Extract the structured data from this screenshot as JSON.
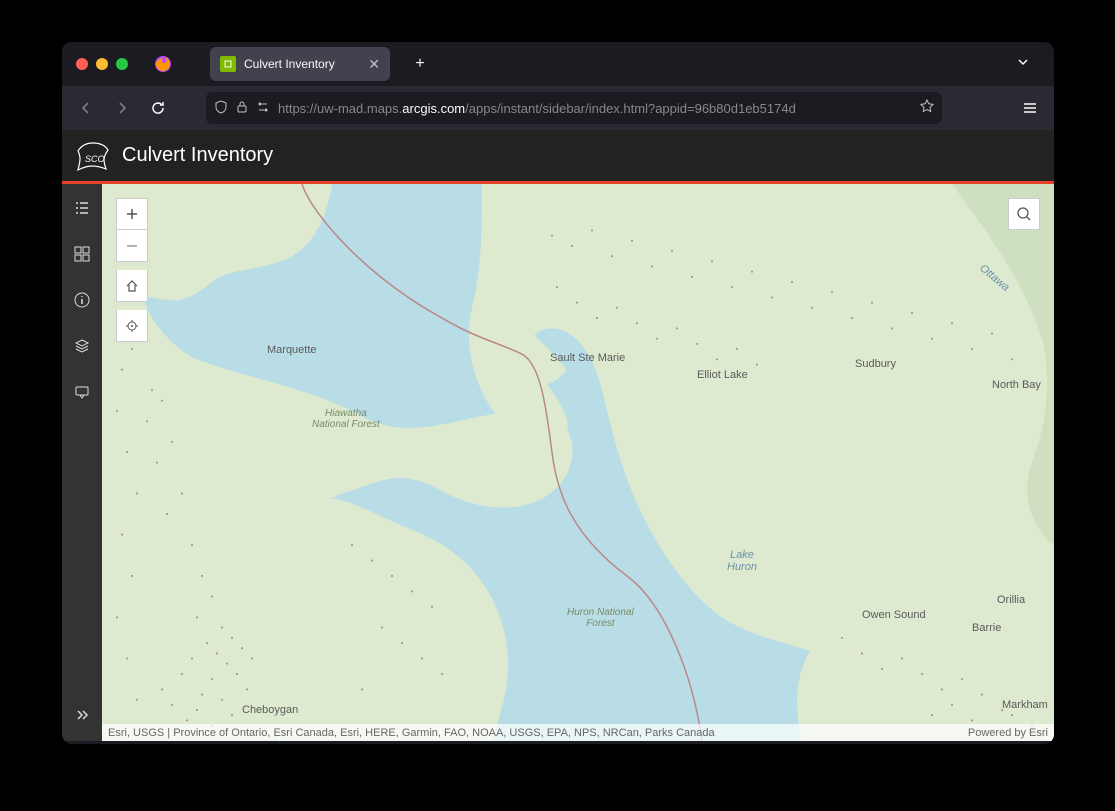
{
  "browser": {
    "tab_title": "Culvert Inventory",
    "url_prefix": "https://uw-mad.maps.",
    "url_bold": "arcgis.com",
    "url_suffix": "/apps/instant/sidebar/index.html?appid=96b80d1eb5174d"
  },
  "app": {
    "logo_text": "SCO",
    "title": "Culvert Inventory"
  },
  "map": {
    "attribution_left": "Esri, USGS | Province of Ontario, Esri Canada, Esri, HERE, Garmin, FAO, NOAA, USGS, EPA, NPS, NRCan, Parks Canada",
    "attribution_right": "Powered by Esri",
    "labels": {
      "marquette": "Marquette",
      "sault": "Sault Ste Marie",
      "elliot": "Elliot Lake",
      "sudbury": "Sudbury",
      "northbay": "North Bay",
      "orillia": "Orillia",
      "barrie": "Barrie",
      "owensound": "Owen Sound",
      "markham": "Markham",
      "cheboygan": "Cheboygan",
      "huron": "Lake\nHuron",
      "ottawa": "Ottawa",
      "hiawatha": "Hiawatha\nNational Forest",
      "huronforest": "Huron National\nForest"
    }
  }
}
